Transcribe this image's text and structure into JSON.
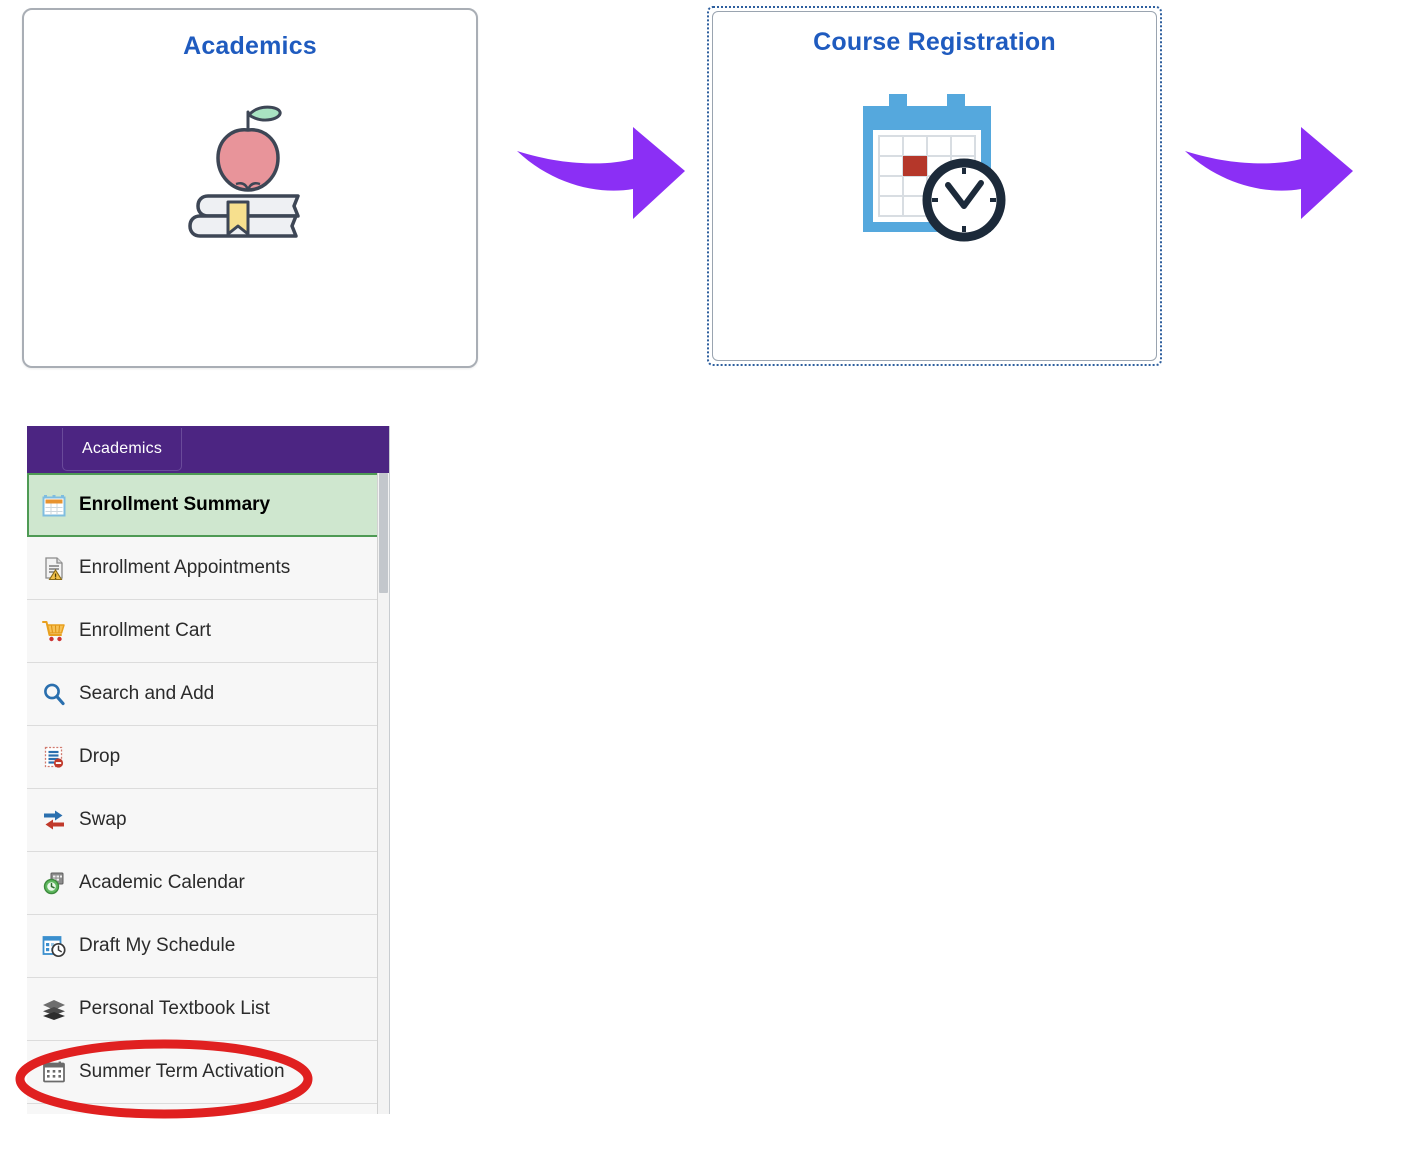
{
  "tiles": [
    {
      "id": "academics",
      "title": "Academics",
      "icon": "apple-on-books-icon",
      "selected": false,
      "border_color": "#a9aeb5",
      "title_color": "#1f5bbf"
    },
    {
      "id": "course-registration",
      "title": "Course Registration",
      "icon": "calendar-clock-icon",
      "selected": true,
      "border_color": "#2e5f9e",
      "title_color": "#1f5bbf"
    }
  ],
  "arrows": [
    {
      "id": "arrow-academics-to-course-registration",
      "direction": "right",
      "color": "#8B2FF5"
    },
    {
      "id": "arrow-course-registration-to-next",
      "direction": "right",
      "color": "#8B2FF5"
    }
  ],
  "sidebar": {
    "header": {
      "label": "Academics",
      "background": "#4c2582"
    },
    "items": [
      {
        "label": "Enrollment Summary",
        "icon": "calendar-icon",
        "selected": true
      },
      {
        "label": "Enrollment Appointments",
        "icon": "document-warning-icon",
        "selected": false
      },
      {
        "label": "Enrollment Cart",
        "icon": "shopping-cart-icon",
        "selected": false
      },
      {
        "label": "Search and Add",
        "icon": "search-icon",
        "selected": false
      },
      {
        "label": "Drop",
        "icon": "document-remove-icon",
        "selected": false
      },
      {
        "label": "Swap",
        "icon": "swap-arrows-icon",
        "selected": false
      },
      {
        "label": "Academic Calendar",
        "icon": "calendar-clock-green-icon",
        "selected": false
      },
      {
        "label": "Draft My Schedule",
        "icon": "schedule-clock-icon",
        "selected": false
      },
      {
        "label": "Personal Textbook List",
        "icon": "books-stack-icon",
        "selected": false
      },
      {
        "label": "Summer Term Activation",
        "icon": "grid-calendar-icon",
        "selected": false
      }
    ],
    "selected_highlight_color": "#cfe7cf",
    "selected_border_color": "#4e9a54"
  },
  "annotation": {
    "type": "ellipse",
    "target_label": "Summer Term Activation",
    "color": "#e02020"
  }
}
